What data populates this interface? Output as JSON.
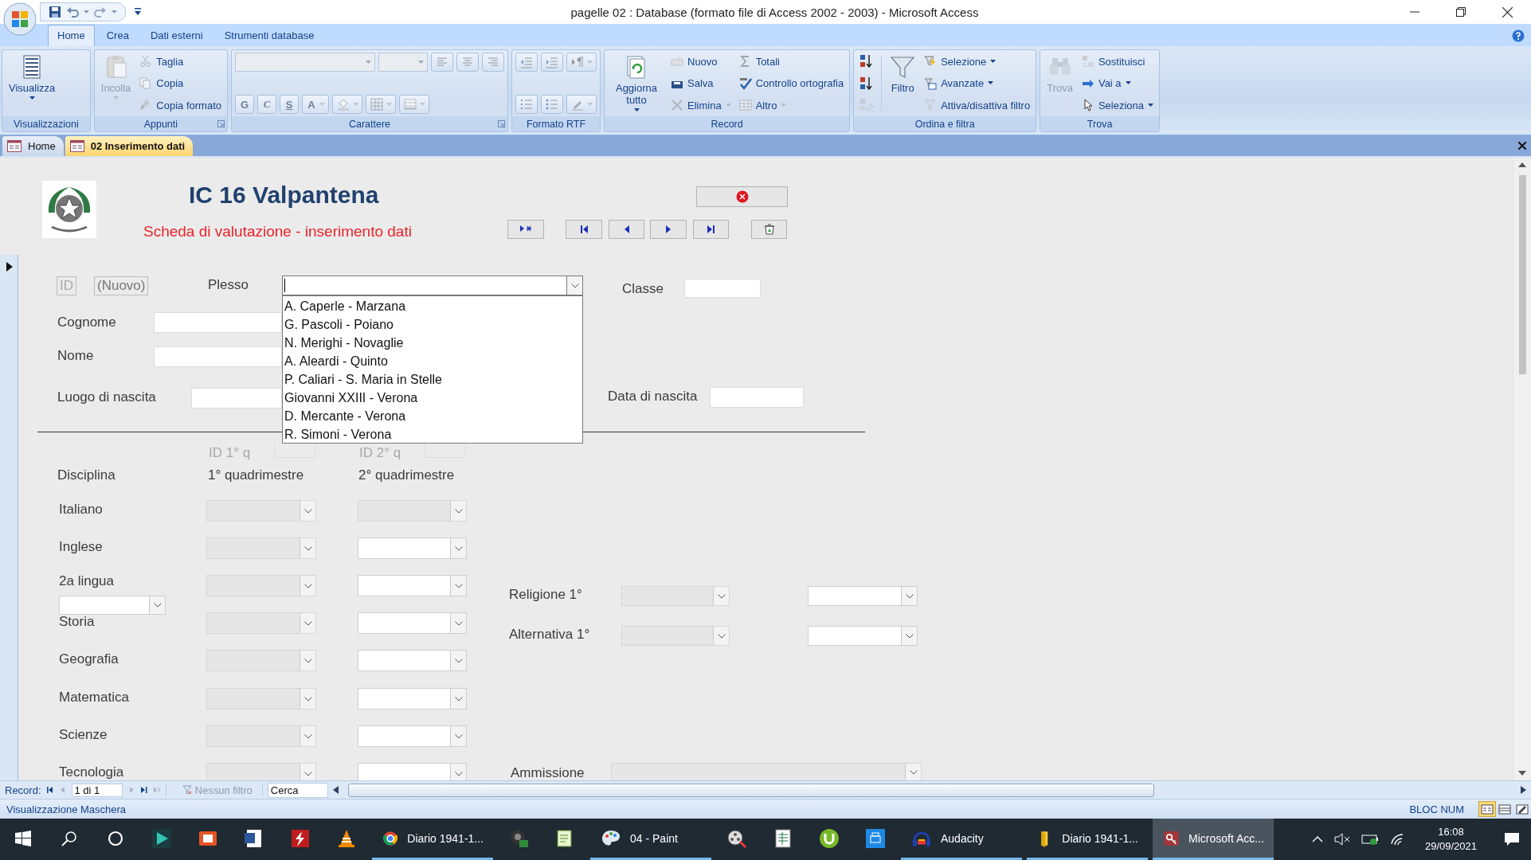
{
  "window": {
    "title": "pagelle 02 : Database (formato file di Access 2002 - 2003) - Microsoft Access"
  },
  "ribbon": {
    "tabs": [
      {
        "label": "Home",
        "selected": true
      },
      {
        "label": "Crea",
        "selected": false
      },
      {
        "label": "Dati esterni",
        "selected": false
      },
      {
        "label": "Strumenti database",
        "selected": false
      }
    ],
    "groups": [
      {
        "title": "Visualizzazioni",
        "items": [
          {
            "kind": "large",
            "label": "Visualizza",
            "disabled": false,
            "menu": true
          }
        ]
      },
      {
        "title": "Appunti",
        "items": [
          {
            "kind": "large",
            "label": "Incolla",
            "disabled": true,
            "menu": true
          },
          {
            "kind": "small",
            "label": "Taglia",
            "disabled": true,
            "menu": false
          },
          {
            "kind": "small",
            "label": "Copia",
            "disabled": true,
            "menu": false
          },
          {
            "kind": "small",
            "label": "Copia formato",
            "disabled": true,
            "menu": false
          }
        ]
      },
      {
        "title": "Carattere",
        "items": [
          {
            "kind": "strip",
            "buttons": [
              {
                "kind": "combo",
                "disabled": true
              },
              {
                "kind": "combo",
                "disabled": true
              },
              {
                "kind": "tool",
                "disabled": true,
                "menu": false
              },
              {
                "kind": "tool",
                "disabled": true,
                "menu": false
              },
              {
                "kind": "tool",
                "disabled": true,
                "menu": false
              }
            ]
          },
          {
            "kind": "strip",
            "buttons": [
              {
                "kind": "letter",
                "label": "G",
                "disabled": true,
                "menu": false
              },
              {
                "kind": "letter",
                "label": "C",
                "disabled": true,
                "menu": false
              },
              {
                "kind": "letter",
                "label": "S",
                "disabled": true,
                "menu": false
              },
              {
                "kind": "letter",
                "label": "A",
                "disabled": true,
                "menu": true
              },
              {
                "kind": "tool",
                "disabled": true,
                "menu": true
              },
              {
                "kind": "tool",
                "disabled": true,
                "menu": true
              },
              {
                "kind": "tool",
                "disabled": true,
                "menu": true
              }
            ]
          }
        ]
      },
      {
        "title": "Formato RTF",
        "items": [
          {
            "kind": "strip",
            "buttons": [
              {
                "kind": "tool",
                "disabled": true,
                "menu": false
              },
              {
                "kind": "tool",
                "disabled": true,
                "menu": false
              },
              {
                "kind": "tool",
                "disabled": true,
                "menu": true
              }
            ]
          },
          {
            "kind": "strip",
            "buttons": [
              {
                "kind": "tool",
                "disabled": true,
                "menu": false
              },
              {
                "kind": "tool",
                "disabled": true,
                "menu": false
              },
              {
                "kind": "tool",
                "disabled": true,
                "menu": true
              }
            ]
          }
        ]
      },
      {
        "title": "Record",
        "items": [
          {
            "kind": "large",
            "label": "Aggiorna tutto",
            "disabled": false,
            "menu": true
          },
          {
            "kind": "small",
            "label": "Nuovo",
            "disabled": true,
            "menu": false
          },
          {
            "kind": "small",
            "label": "Salva",
            "disabled": false,
            "menu": false
          },
          {
            "kind": "small",
            "label": "Elimina",
            "disabled": true,
            "menu": true
          },
          {
            "kind": "small",
            "label": "Totali",
            "disabled": true,
            "menu": false
          },
          {
            "kind": "small",
            "label": "Controllo ortografia",
            "disabled": false,
            "menu": false
          },
          {
            "kind": "small",
            "label": "Altro",
            "disabled": true,
            "menu": true
          }
        ]
      },
      {
        "title": "Ordina e filtra",
        "items": [
          {
            "kind": "tool",
            "disabled": false,
            "menu": false
          },
          {
            "kind": "tool",
            "disabled": false,
            "menu": false
          },
          {
            "kind": "tool",
            "disabled": true,
            "menu": false
          },
          {
            "kind": "large",
            "label": "Filtro",
            "disabled": false,
            "menu": false
          },
          {
            "kind": "small",
            "label": "Selezione",
            "disabled": false,
            "menu": true
          },
          {
            "kind": "small",
            "label": "Avanzate",
            "disabled": false,
            "menu": true
          },
          {
            "kind": "small",
            "label": "Attiva/disattiva filtro",
            "disabled": true,
            "menu": false
          }
        ]
      },
      {
        "title": "Trova",
        "items": [
          {
            "kind": "large",
            "label": "Trova",
            "disabled": true,
            "menu": false
          },
          {
            "kind": "small",
            "label": "Sostituisci",
            "disabled": true,
            "menu": false
          },
          {
            "kind": "small",
            "label": "Vai a",
            "disabled": false,
            "menu": true
          },
          {
            "kind": "small",
            "label": "Seleziona",
            "disabled": false,
            "menu": true
          }
        ]
      }
    ]
  },
  "document_tabs": [
    {
      "label": "Home",
      "selected": false
    },
    {
      "label": "02 Inserimento dati",
      "selected": true
    }
  ],
  "form": {
    "title": "IC 16 Valpantena",
    "subtitle": "Scheda di valutazione - inserimento dati",
    "id": {
      "label": "ID",
      "value": "(Nuovo)"
    },
    "plesso": {
      "label": "Plesso",
      "expanded": true,
      "options": [
        "A. Caperle - Marzana",
        "G. Pascoli - Poiano",
        "N. Merighi - Novaglie",
        "A. Aleardi - Quinto",
        "P. Caliari - S. Maria in Stelle",
        "Giovanni XXIII - Verona",
        "D. Mercante - Verona",
        "R. Simoni - Verona"
      ]
    },
    "classe": {
      "label": "Classe"
    },
    "cognome": {
      "label": "Cognome"
    },
    "nome": {
      "label": "Nome"
    },
    "luogo_nascita": {
      "label": "Luogo di nascita"
    },
    "data_nascita": {
      "label": "Data di nascita"
    },
    "id_quadrimestre": [
      {
        "label": "ID 1° q"
      },
      {
        "label": "ID 2° q"
      }
    ],
    "grid_header": [
      "Disciplina",
      "1° quadrimestre",
      "2° quadrimestre"
    ],
    "subjects": [
      {
        "name": "Italiano",
        "q1_disabled": true,
        "q2_disabled": true
      },
      {
        "name": "Inglese",
        "q1_disabled": true,
        "q2_disabled": false
      },
      {
        "name": "2a lingua",
        "q1_disabled": true,
        "q2_disabled": false
      },
      {
        "name": "Storia",
        "q1_disabled": true,
        "q2_disabled": false
      },
      {
        "name": "Geografia",
        "q1_disabled": true,
        "q2_disabled": false
      },
      {
        "name": "Matematica",
        "q1_disabled": true,
        "q2_disabled": false
      },
      {
        "name": "Scienze",
        "q1_disabled": true,
        "q2_disabled": false
      },
      {
        "name": "Tecnologia",
        "q1_disabled": true,
        "q2_disabled": false
      }
    ],
    "second_language_choice": {
      "disabled": false
    },
    "extra": [
      {
        "name": "Religione 1°",
        "q1_disabled": true,
        "q2_disabled": false
      },
      {
        "name": "Alternativa 1°",
        "q1_disabled": true,
        "q2_disabled": false
      }
    ],
    "ammissione": {
      "label": "Ammissione",
      "disabled": true
    }
  },
  "record_nav": {
    "label": "Record:",
    "position": "1 di 1",
    "filter": "Nessun filtro",
    "search": {
      "placeholder": "Cerca"
    }
  },
  "status_bar": {
    "text": "Visualizzazione Maschera",
    "indicator": "BLOC NUM",
    "views": [
      {
        "selected": true
      },
      {
        "selected": false
      },
      {
        "selected": false
      }
    ]
  },
  "taskbar": {
    "apps": [
      {
        "running": false,
        "active": false
      },
      {
        "running": false,
        "active": false
      },
      {
        "running": false,
        "active": false
      },
      {
        "running": false,
        "active": false
      },
      {
        "running": false,
        "active": false
      },
      {
        "label": "Diario 1941-1...",
        "running": true,
        "active": false
      },
      {
        "running": false,
        "active": false
      },
      {
        "running": false,
        "active": false
      },
      {
        "label": "04 - Paint",
        "running": true,
        "active": false
      },
      {
        "running": false,
        "active": false
      },
      {
        "running": false,
        "active": false
      },
      {
        "running": false,
        "active": false
      },
      {
        "running": false,
        "active": false
      },
      {
        "label": "Audacity",
        "running": true,
        "active": false
      },
      {
        "label": "Diario 1941-1...",
        "running": true,
        "active": false
      },
      {
        "label": "Microsoft Acc...",
        "running": true,
        "active": true
      }
    ],
    "time": "16:08",
    "date": "29/09/2021"
  }
}
